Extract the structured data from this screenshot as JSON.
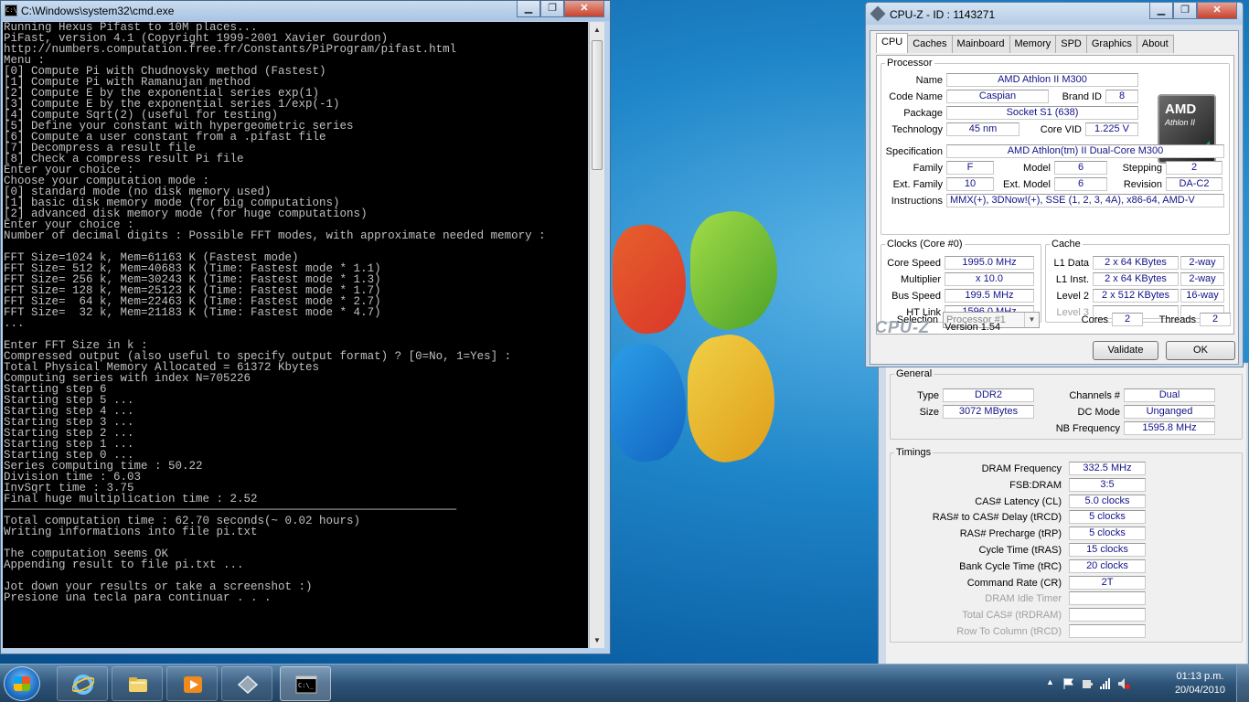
{
  "cmd": {
    "title": "C:\\Windows\\system32\\cmd.exe",
    "icon": "console-icon",
    "minimize": "▁",
    "maximize": "❐",
    "close": "✕",
    "lines": [
      "Running Hexus Pifast to 10M places...",
      "PiFast, version 4.1 (Copyright 1999-2001 Xavier Gourdon)",
      "http://numbers.computation.free.fr/Constants/PiProgram/pifast.html",
      "Menu :",
      "[0] Compute Pi with Chudnovsky method (Fastest)",
      "[1] Compute Pi with Ramanujan method",
      "[2] Compute E by the exponential series exp(1)",
      "[3] Compute E by the exponential series 1/exp(-1)",
      "[4] Compute Sqrt(2) (useful for testing)",
      "[5] Define your constant with hypergeometric series",
      "[6] Compute a user constant from a .pifast file",
      "[7] Decompress a result file",
      "[8] Check a compress result Pi file",
      "Enter your choice :",
      "Choose your computation mode :",
      "[0] standard mode (no disk memory used)",
      "[1] basic disk memory mode (for big computations)",
      "[2] advanced disk memory mode (for huge computations)",
      "Enter your choice :",
      "Number of decimal digits : Possible FFT modes, with approximate needed memory :",
      "",
      "FFT Size=1024 k, Mem=61163 K (Fastest mode)",
      "FFT Size= 512 k, Mem=40683 K (Time: Fastest mode * 1.1)",
      "FFT Size= 256 k, Mem=30243 K (Time: Fastest mode * 1.3)",
      "FFT Size= 128 k, Mem=25123 K (Time: Fastest mode * 1.7)",
      "FFT Size=  64 k, Mem=22463 K (Time: Fastest mode * 2.7)",
      "FFT Size=  32 k, Mem=21183 K (Time: Fastest mode * 4.7)",
      "...",
      "",
      "Enter FFT Size in k :",
      "Compressed output (also useful to specify output format) ? [0=No, 1=Yes] :",
      "Total Physical Memory Allocated = 61372 Kbytes",
      "Computing series with index N=705226",
      "Starting step 6",
      "Starting step 5 ...",
      "Starting step 4 ...",
      "Starting step 3 ...",
      "Starting step 2 ...",
      "Starting step 1 ...",
      "Starting step 0 ...",
      "Series computing time : 50.22",
      "Division time : 6.03",
      "InvSqrt time : 3.75",
      "Final huge multiplication time : 2.52",
      "──────────────────────────────────────────────────────────────────",
      "Total computation time : 62.70 seconds(~ 0.02 hours)",
      "Writing informations into file pi.txt",
      "",
      "The computation seems OK",
      "Appending result to file pi.txt ...",
      "",
      "Jot down your results or take a screenshot :)",
      "Presione una tecla para continuar . . ."
    ]
  },
  "cpuz": {
    "title": "CPU-Z - ID : 1143271",
    "tabs": [
      "CPU",
      "Caches",
      "Mainboard",
      "Memory",
      "SPD",
      "Graphics",
      "About"
    ],
    "active_tab": "CPU",
    "processor": {
      "legend": "Processor",
      "name_label": "Name",
      "name": "AMD Athlon II M300",
      "codename_label": "Code Name",
      "codename": "Caspian",
      "brandid_label": "Brand ID",
      "brandid": "8",
      "package_label": "Package",
      "package": "Socket S1 (638)",
      "technology_label": "Technology",
      "technology": "45 nm",
      "corevid_label": "Core VID",
      "corevid": "1.225 V",
      "spec_label": "Specification",
      "spec": "AMD Athlon(tm) II Dual-Core M300",
      "family_label": "Family",
      "family": "F",
      "model_label": "Model",
      "model": "6",
      "stepping_label": "Stepping",
      "stepping": "2",
      "extfamily_label": "Ext. Family",
      "extfamily": "10",
      "extmodel_label": "Ext. Model",
      "extmodel": "6",
      "revision_label": "Revision",
      "revision": "DA-C2",
      "instr_label": "Instructions",
      "instr": "MMX(+), 3DNow!(+), SSE (1, 2, 3, 4A), x86-64, AMD-V",
      "logo_brand": "AMD",
      "logo_line": "Athlon II",
      "logo_sub": "X2"
    },
    "clocks": {
      "legend": "Clocks (Core #0)",
      "corespeed_label": "Core Speed",
      "corespeed": "1995.0 MHz",
      "multiplier_label": "Multiplier",
      "multiplier": "x 10.0",
      "busspeed_label": "Bus Speed",
      "busspeed": "199.5 MHz",
      "htlink_label": "HT Link",
      "htlink": "1596.0 MHz"
    },
    "cache": {
      "legend": "Cache",
      "l1d_label": "L1 Data",
      "l1d": "2 x 64 KBytes",
      "l1d_way": "2-way",
      "l1i_label": "L1 Inst.",
      "l1i": "2 x 64 KBytes",
      "l1i_way": "2-way",
      "l2_label": "Level 2",
      "l2": "2 x 512 KBytes",
      "l2_way": "16-way",
      "l3_label": "Level 3"
    },
    "selection_label": "Selection",
    "selection": "Processor #1",
    "cores_label": "Cores",
    "cores": "2",
    "threads_label": "Threads",
    "threads": "2",
    "footer_logo": "CPU-Z",
    "version": "Version 1.54",
    "validate": "Validate",
    "ok": "OK"
  },
  "memory": {
    "general_legend": "General",
    "type_label": "Type",
    "type": "DDR2",
    "size_label": "Size",
    "size": "3072 MBytes",
    "channels_label": "Channels #",
    "channels": "Dual",
    "dcmode_label": "DC Mode",
    "dcmode": "Unganged",
    "nbfreq_label": "NB Frequency",
    "nbfreq": "1595.8 MHz",
    "timings_legend": "Timings",
    "timings": [
      {
        "label": "DRAM Frequency",
        "value": "332.5 MHz"
      },
      {
        "label": "FSB:DRAM",
        "value": "3:5"
      },
      {
        "label": "CAS# Latency (CL)",
        "value": "5.0 clocks"
      },
      {
        "label": "RAS# to CAS# Delay (tRCD)",
        "value": "5 clocks"
      },
      {
        "label": "RAS# Precharge (tRP)",
        "value": "5 clocks"
      },
      {
        "label": "Cycle Time (tRAS)",
        "value": "15 clocks"
      },
      {
        "label": "Bank Cycle Time (tRC)",
        "value": "20 clocks"
      },
      {
        "label": "Command Rate (CR)",
        "value": "2T"
      },
      {
        "label": "DRAM Idle Timer",
        "value": ""
      },
      {
        "label": "Total CAS# (tRDRAM)",
        "value": ""
      },
      {
        "label": "Row To Column (tRCD)",
        "value": ""
      }
    ]
  },
  "taskbar": {
    "items": [
      "internet-explorer-icon",
      "folder-icon",
      "media-player-icon",
      "cpuz-icon",
      "cmd-icon"
    ],
    "time": "01:13 p.m.",
    "date": "20/04/2010"
  }
}
